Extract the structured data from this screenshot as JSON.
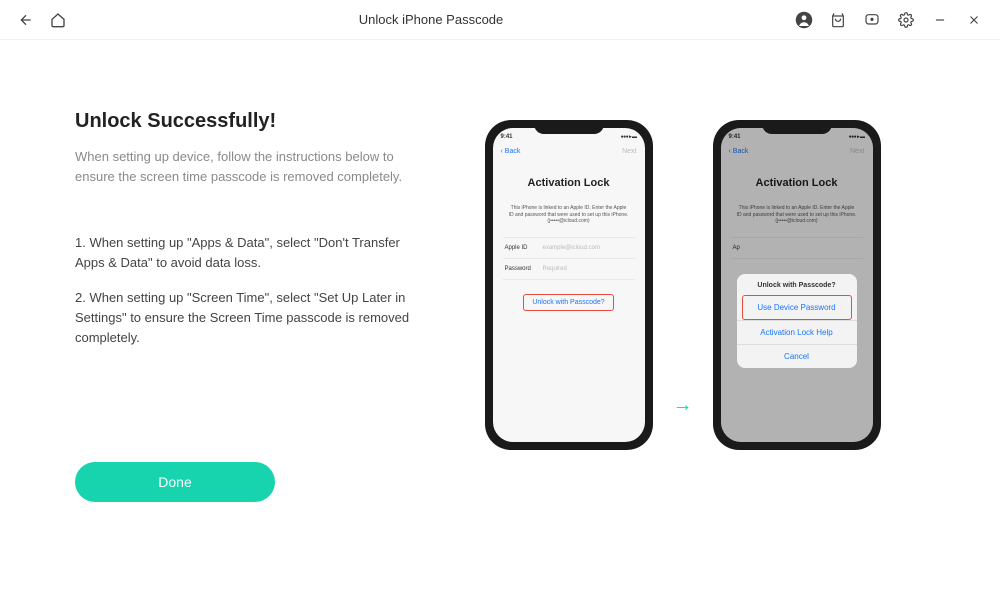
{
  "titlebar": {
    "title": "Unlock iPhone Passcode"
  },
  "content": {
    "heading": "Unlock Successfully!",
    "subtext": "When setting up device, follow the instructions below to ensure the screen time passcode is removed completely.",
    "step1": "1. When setting up \"Apps & Data\", select \"Don't Transfer Apps & Data\" to avoid data loss.",
    "step2": "2. When setting up \"Screen Time\", select \"Set Up Later in Settings\" to ensure the Screen Time passcode is removed completely.",
    "done": "Done"
  },
  "phone": {
    "time": "9:41",
    "back": "‹ Back",
    "next": "Next",
    "activation_title": "Activation Lock",
    "activation_text": "This iPhone is linked to an Apple ID. Enter the Apple ID and password that were used to set up this iPhone. (j•••••@icloud.com)",
    "appleid_label": "Apple ID",
    "appleid_placeholder": "example@icloud.com",
    "password_label": "Password",
    "password_placeholder": "Required",
    "unlock_link": "Unlock with Passcode?"
  },
  "popup": {
    "title": "Unlock with Passcode?",
    "use_password": "Use Device Password",
    "help": "Activation Lock Help",
    "cancel": "Cancel"
  }
}
